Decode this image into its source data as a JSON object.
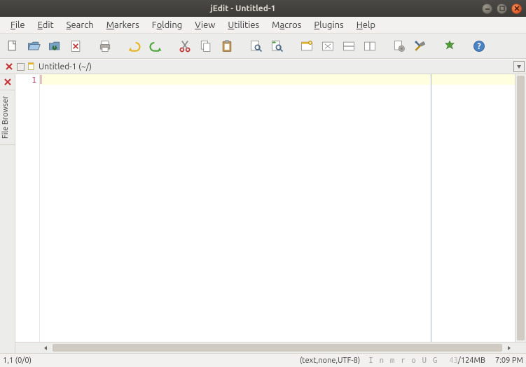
{
  "window": {
    "title": "jEdit - Untitled-1"
  },
  "menu": {
    "file": "File",
    "edit": "Edit",
    "search": "Search",
    "markers": "Markers",
    "folding": "Folding",
    "view": "View",
    "utilities": "Utilities",
    "macros": "Macros",
    "plugins": "Plugins",
    "help": "Help"
  },
  "buffer": {
    "name": "Untitled-1 (~/)"
  },
  "sidebar": {
    "file_browser": "File Browser"
  },
  "gutter": {
    "line1": "1"
  },
  "status": {
    "position": "1,1 (0/0)",
    "mode": "(text,none,UTF-8)",
    "flags": "I n m r o U G",
    "mem_used": "43",
    "mem_sep": "/",
    "mem_total": "124MB",
    "time": "7:09 PM"
  }
}
